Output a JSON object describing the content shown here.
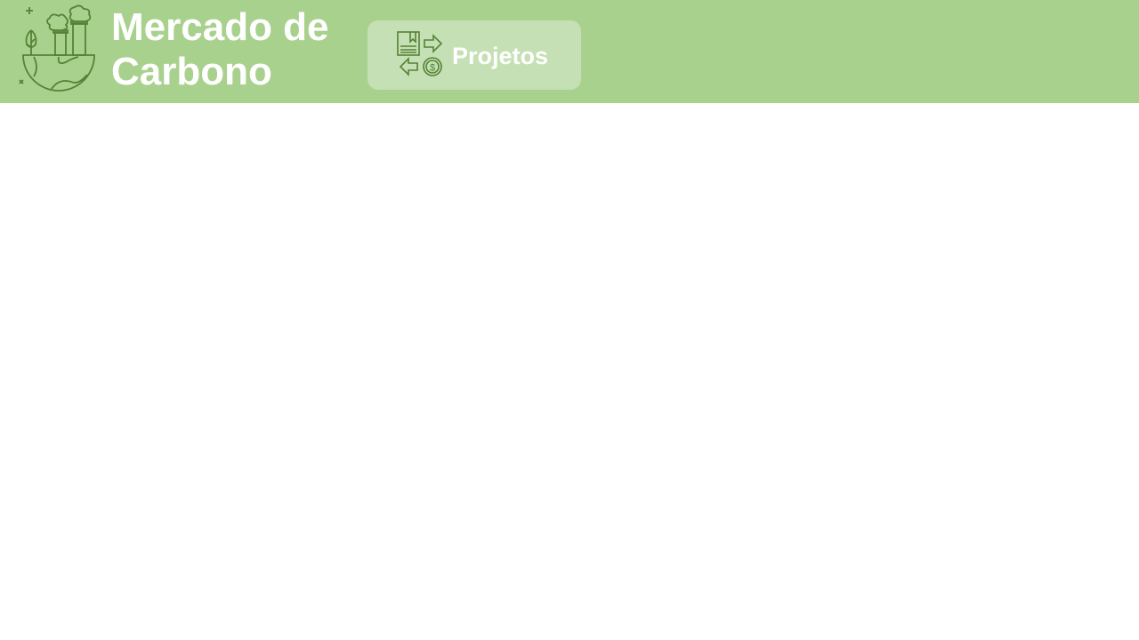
{
  "header": {
    "title_line1": "Mercado de",
    "title_line2": "Carbono",
    "logo_icon": "earth-factory-icon",
    "nav": [
      {
        "label": "Projetos",
        "icon": "exchange-document-money-icon"
      }
    ]
  },
  "colors": {
    "header_bg": "#a9d18e",
    "button_bg": "#c5e0b4",
    "icon": "#548235",
    "text": "#ffffff"
  }
}
